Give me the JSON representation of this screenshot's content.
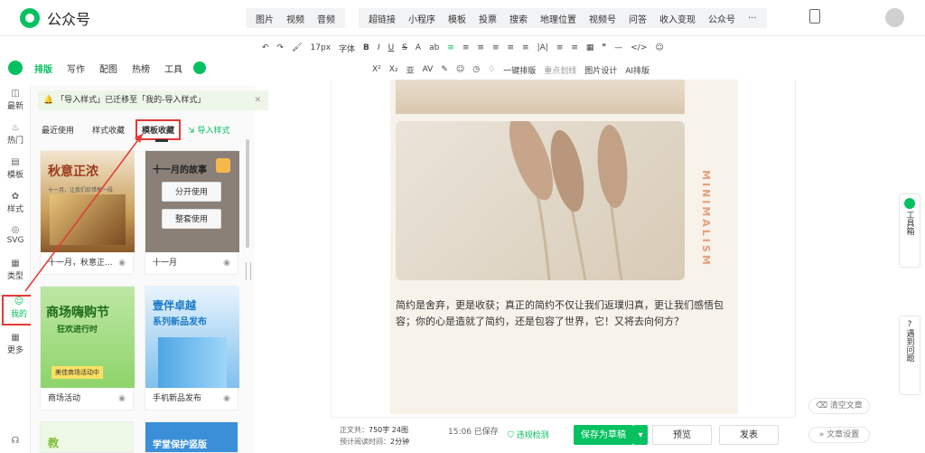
{
  "app": {
    "title": "公众号"
  },
  "topbar": {
    "media": [
      "图片",
      "视频",
      "音频"
    ],
    "insert": [
      "超链接",
      "小程序",
      "模板",
      "投票",
      "搜索",
      "地理位置",
      "视频号",
      "问答",
      "收入变现",
      "公众号"
    ],
    "more": "···"
  },
  "format": {
    "row1": [
      "↶",
      "↷",
      "🖌",
      "17px",
      "字体",
      "B",
      "I",
      "U",
      "S",
      "A",
      "ab",
      "≡",
      "≡",
      "≡",
      "≡",
      "≡",
      "≡",
      "|A|",
      "≡",
      "≡",
      "▦",
      "❞",
      "—",
      "</>",
      "☺"
    ],
    "row2": [
      "X²",
      "X₂",
      "亚",
      "AV",
      "✎",
      "☺",
      "◷",
      "♢",
      "一键排版",
      "重点划线",
      "图片设计",
      "AI排版"
    ]
  },
  "sidebar": {
    "app_tabs": [
      "排版",
      "写作",
      "配图",
      "热榜",
      "工具"
    ],
    "nav": [
      "最新",
      "热门",
      "模板",
      "样式",
      "SVG",
      "类型",
      "我的",
      "更多"
    ],
    "notice": "「导入样式」已迁移至「我的-导入样式」",
    "tabs": [
      "最近使用",
      "样式收藏",
      "模板收藏"
    ],
    "import": "导入样式",
    "cards": [
      {
        "name": "十一月，秋意正...",
        "thumb_text": "秋意正浓",
        "thumb_sub": "十一月，让我们珍惜每一段"
      },
      {
        "name": "十一月",
        "thumb_text": "十一月的故事",
        "btn1": "分开使用",
        "btn2": "整套使用"
      },
      {
        "name": "商场活动",
        "thumb_text": "商场嗨购节",
        "thumb_sub": "狂欢进行时",
        "extra": "美佳商场活动中"
      },
      {
        "name": "手机新品发布",
        "thumb_text": "壹伴卓越",
        "thumb_sub": "系列新品发布"
      },
      {
        "name": "",
        "thumb_text": "教"
      },
      {
        "name": "",
        "thumb_text": "学堂保护竖版"
      }
    ]
  },
  "editor": {
    "vertical_word": "MINIMALISM",
    "paragraph": "简约是舍弃，更是收获；真正的简约不仅让我们返璞归真，更让我们感悟包容；你的心是造就了简约，还是包容了世界，它！又将去向何方？"
  },
  "bottom": {
    "wordcount_label": "正文共：",
    "wordcount": "750字 24图",
    "readtime_label": "预计阅读时间：",
    "readtime": "2分钟",
    "saved": "15:06 已保存",
    "check": "违规检测",
    "save_draft": "保存为草稿",
    "preview": "预览",
    "publish": "发表"
  },
  "right": {
    "toolbox": "工具箱",
    "help": "遇到问题",
    "clear": "清空文章",
    "settings": "文章设置"
  },
  "colors": {
    "brand": "#07c160",
    "red": "#e53935"
  }
}
